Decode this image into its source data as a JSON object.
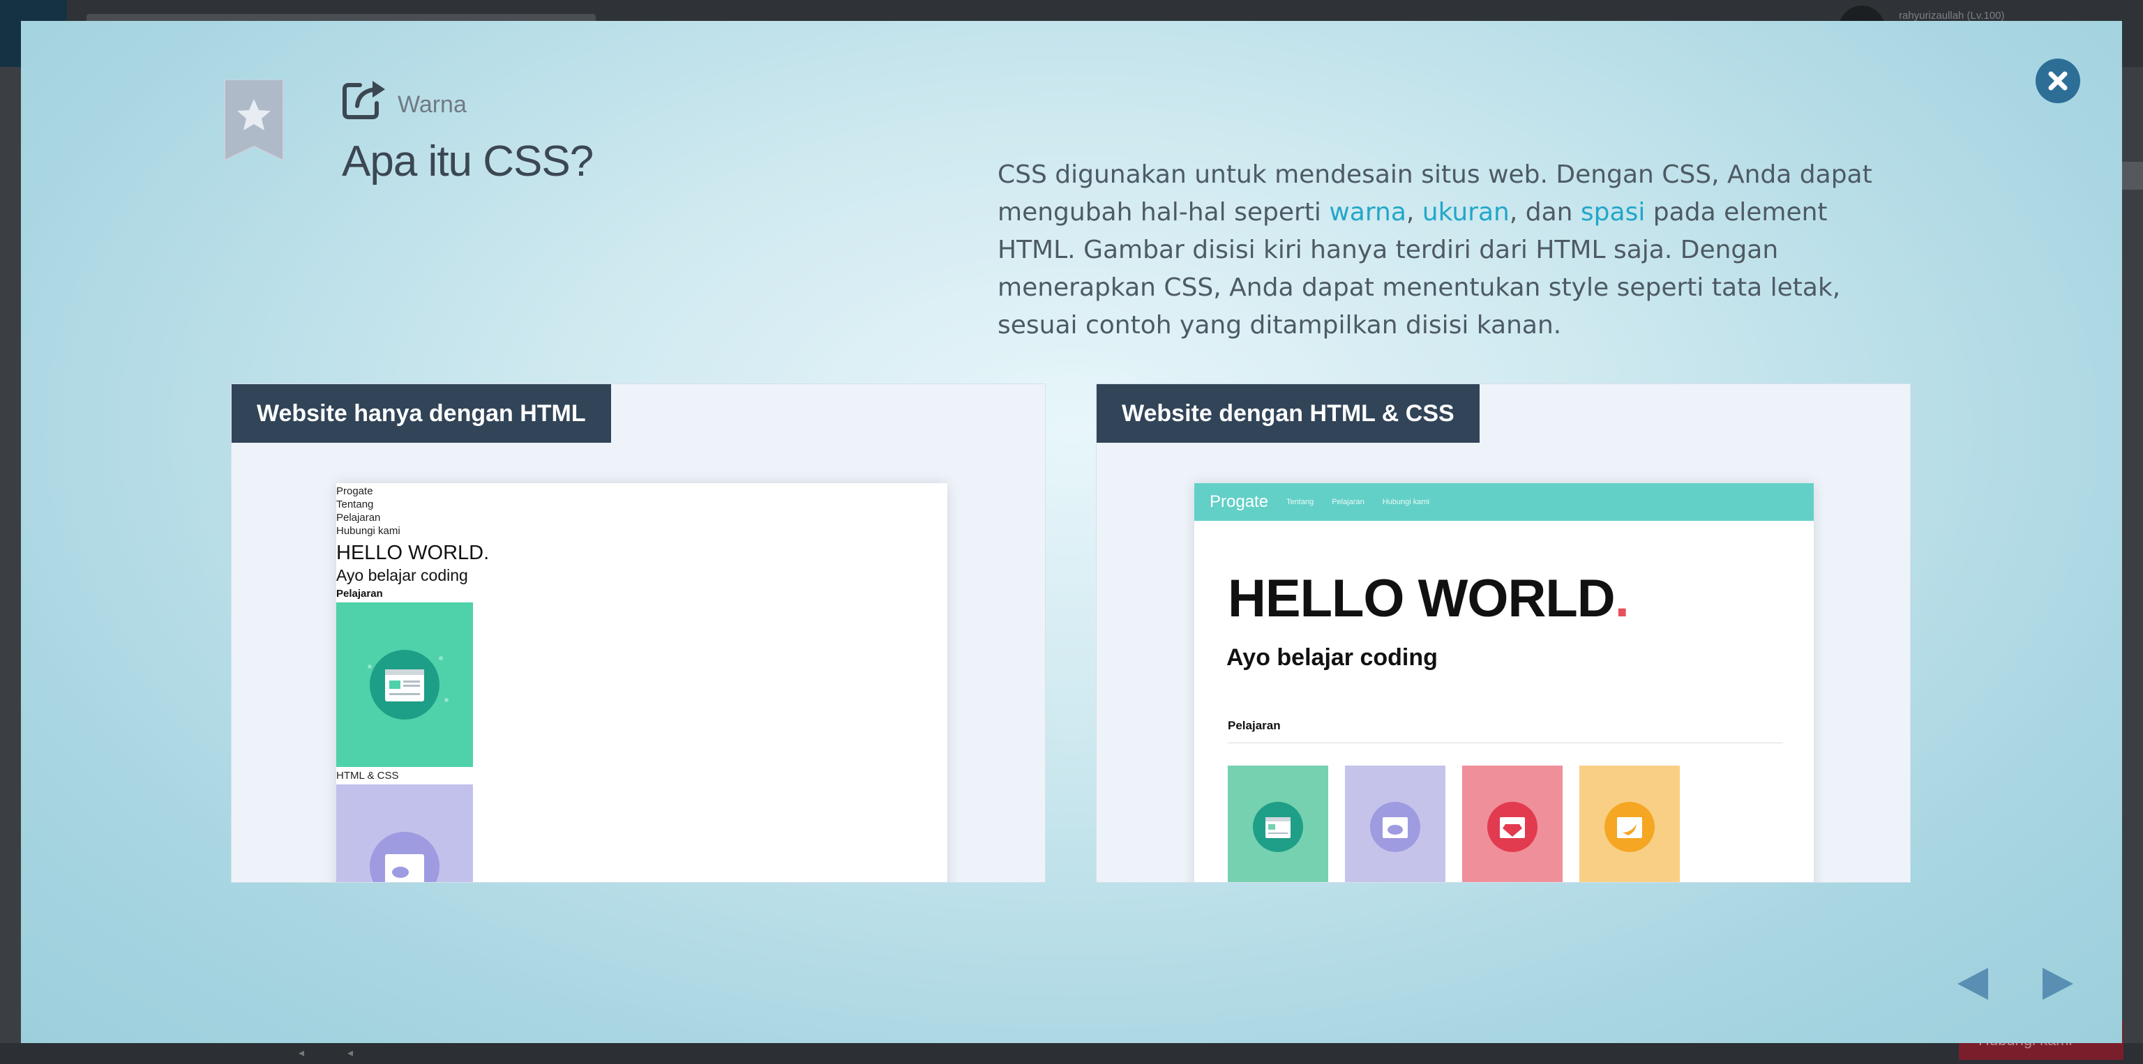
{
  "background": {
    "username": "rahyurizaullah (Lv.100)",
    "help_button": "Hubungi kami"
  },
  "modal": {
    "category_label": "Warna",
    "title": "Apa itu CSS?",
    "description": {
      "part1": "CSS digunakan untuk mendesain situs web. Dengan CSS, Anda dapat mengubah hal-hal seperti ",
      "link1": "warna",
      "sep1": ", ",
      "link2": "ukuran",
      "sep2": ", dan ",
      "link3": "spasi",
      "part2": " pada element HTML. Gambar disisi kiri hanya terdiri dari HTML saja. Dengan menerapkan CSS, Anda dapat menentukan style seperti tata letak, sesuai contoh yang ditampilkan disisi kanan."
    },
    "left_panel": {
      "tab_label": "Website hanya dengan HTML",
      "nav": [
        "Progate",
        "Tentang",
        "Pelajaran",
        "Hubungi kami"
      ],
      "heading1": "HELLO WORLD.",
      "heading2": "Ayo belajar coding",
      "section": "Pelajaran",
      "card_caption": "HTML & CSS"
    },
    "right_panel": {
      "tab_label": "Website dengan HTML & CSS",
      "brand": "Progate",
      "nav_links": [
        "Tentang",
        "Pelajaran",
        "Hubungi kami"
      ],
      "heading1": "HELLO WORLD",
      "heading1_dot": ".",
      "heading2": "Ayo belajar coding",
      "section": "Pelajaran"
    },
    "colors": {
      "accent": "#21a7c8",
      "tab_bg": "#314458",
      "close_bg": "#2d6e97",
      "arrow": "#5a8fb4",
      "card_colors": [
        "#76d1b0",
        "#c5c3ea",
        "#ef8f99",
        "#f8cf84"
      ]
    },
    "icons": {
      "close": "close-icon",
      "external_link": "external-link-icon",
      "bookmark": "bookmark-star-icon",
      "prev": "prev-arrow-icon",
      "next": "next-arrow-icon"
    }
  }
}
